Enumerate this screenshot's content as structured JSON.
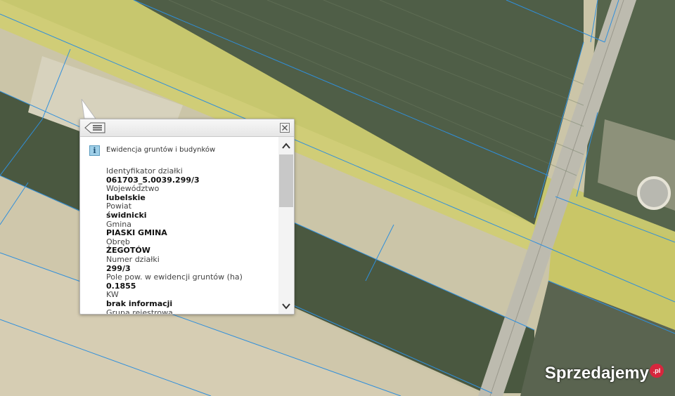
{
  "map": {
    "colors": {
      "bare_field": "#cbc5a8",
      "yellow_field": "#c8c96a",
      "green_field": "#4e5d45",
      "dark_green": "#3f4c39",
      "road": "#b9b7ac",
      "parcel_line": "#2f8fdc"
    }
  },
  "popup": {
    "back_icon": "list-back-icon",
    "close_icon": "close-icon",
    "layer_title": "Ewidencja gruntów i budynków",
    "rows": [
      {
        "label": "Identyfikator działki",
        "value": "061703_5.0039.299/3"
      },
      {
        "label": "Województwo",
        "value": "lubelskie"
      },
      {
        "label": "Powiat",
        "value": "świdnicki"
      },
      {
        "label": "Gmina",
        "value": "PIASKI GMINA"
      },
      {
        "label": "Obręb",
        "value": "ŻEGOTÓW"
      },
      {
        "label": "Numer działki",
        "value": "299/3"
      },
      {
        "label": "Pole pow. w ewidencji gruntów (ha)",
        "value": "0.1855"
      },
      {
        "label": "KW",
        "value": "brak informacji"
      },
      {
        "label": "Grupa rejestrowa",
        "value": ""
      }
    ]
  },
  "watermark": {
    "text": "Sprzedajemy",
    "badge": ".pl"
  }
}
